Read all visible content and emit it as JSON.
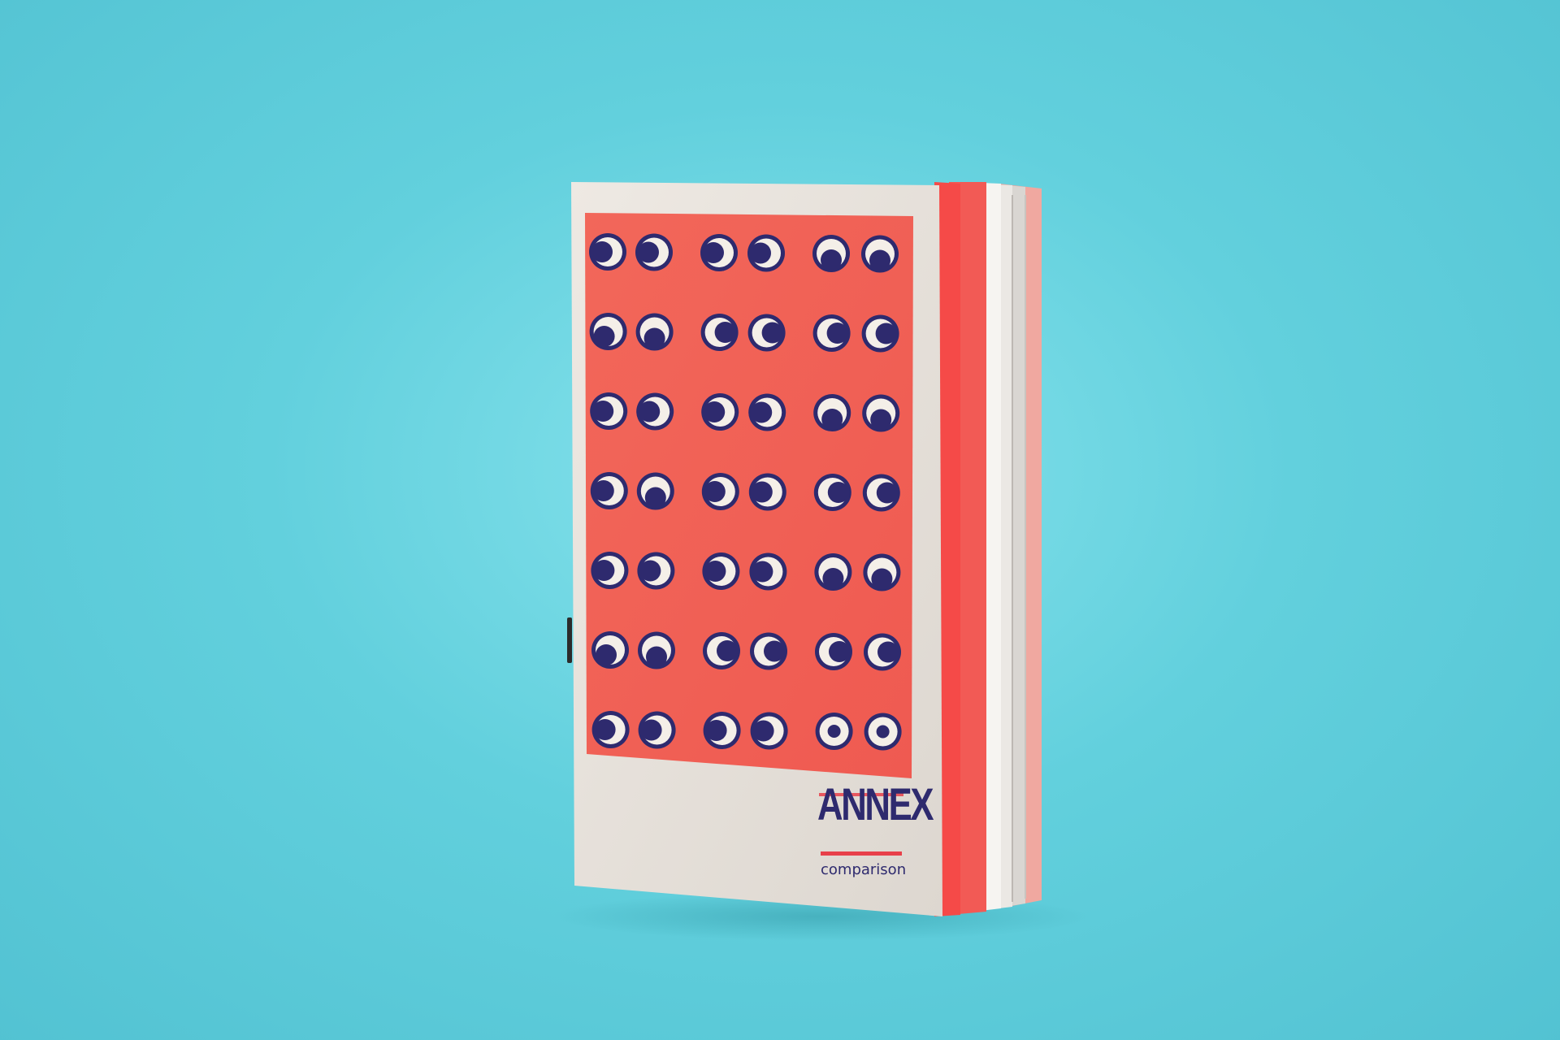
{
  "cover": {
    "title": "ANNEX",
    "subtitle": "comparison"
  },
  "colors": {
    "background": "#62d0dd",
    "paper": "#e9e4de",
    "print_red": "#f2675a",
    "ink": "#2e2a6e",
    "accent_red": "#e8404a"
  },
  "eyes": {
    "rows": 7,
    "pairs_per_row": 3,
    "pupil_directions": [
      [
        "left",
        "left",
        "left",
        "left",
        "down",
        "down"
      ],
      [
        "down-left",
        "down",
        "right",
        "right",
        "right",
        "right"
      ],
      [
        "left",
        "left",
        "left",
        "left",
        "down",
        "down"
      ],
      [
        "left",
        "down",
        "left",
        "left",
        "right",
        "right"
      ],
      [
        "left",
        "left",
        "left",
        "left",
        "down",
        "down"
      ],
      [
        "down-left",
        "down",
        "right",
        "right",
        "right",
        "right"
      ],
      [
        "left",
        "left",
        "left",
        "left",
        "center",
        "center"
      ]
    ]
  }
}
